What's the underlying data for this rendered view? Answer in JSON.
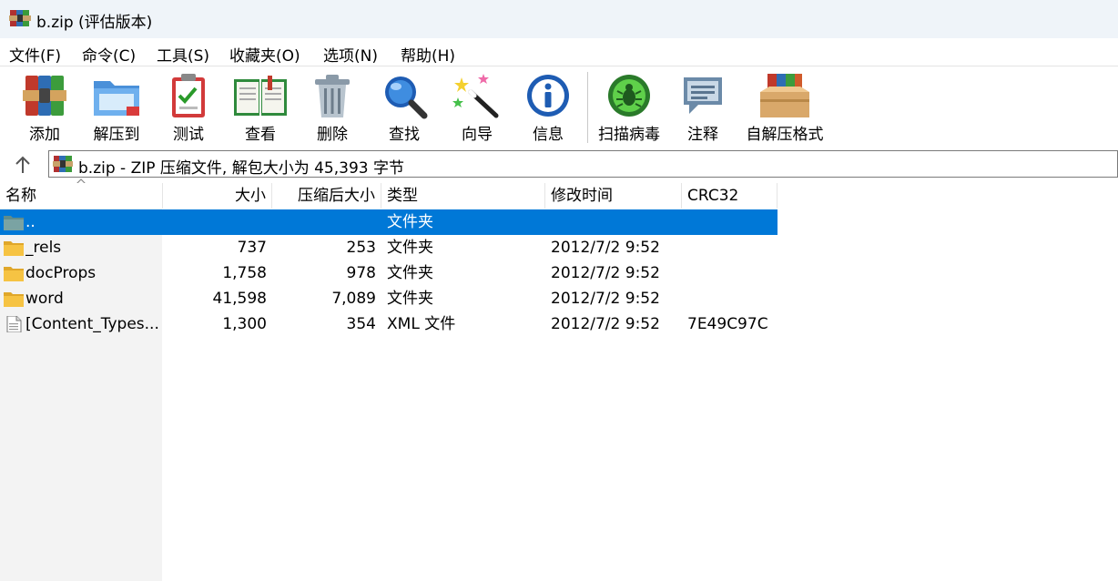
{
  "window": {
    "title": "b.zip (评估版本)"
  },
  "menu": [
    "文件(F)",
    "命令(C)",
    "工具(S)",
    "收藏夹(O)",
    "选项(N)",
    "帮助(H)"
  ],
  "toolbar": {
    "add": "添加",
    "extract": "解压到",
    "test": "测试",
    "view": "查看",
    "delete": "删除",
    "find": "查找",
    "wizard": "向导",
    "info": "信息",
    "scan": "扫描病毒",
    "comment": "注释",
    "sfx": "自解压格式"
  },
  "address": {
    "path": "b.zip - ZIP 压缩文件, 解包大小为 45,393 字节"
  },
  "columns": {
    "name": "名称",
    "size": "大小",
    "packed": "压缩后大小",
    "type": "类型",
    "modified": "修改时间",
    "crc": "CRC32"
  },
  "files": [
    {
      "name": "..",
      "size": "",
      "packed": "",
      "type": "文件夹",
      "modified": "",
      "crc": "",
      "icon": "folder-up-icon"
    },
    {
      "name": "_rels",
      "size": "737",
      "packed": "253",
      "type": "文件夹",
      "modified": "2012/7/2 9:52",
      "crc": "",
      "icon": "folder-icon"
    },
    {
      "name": "docProps",
      "size": "1,758",
      "packed": "978",
      "type": "文件夹",
      "modified": "2012/7/2 9:52",
      "crc": "",
      "icon": "folder-icon"
    },
    {
      "name": "word",
      "size": "41,598",
      "packed": "7,089",
      "type": "文件夹",
      "modified": "2012/7/2 9:52",
      "crc": "",
      "icon": "folder-icon"
    },
    {
      "name": "[Content_Types...",
      "size": "1,300",
      "packed": "354",
      "type": "XML 文件",
      "modified": "2012/7/2 9:52",
      "crc": "7E49C97C",
      "icon": "file-icon"
    }
  ],
  "colors": {
    "selection": "#0078d7",
    "titlebar": "#eff4f9",
    "folder": "#f6c343"
  }
}
